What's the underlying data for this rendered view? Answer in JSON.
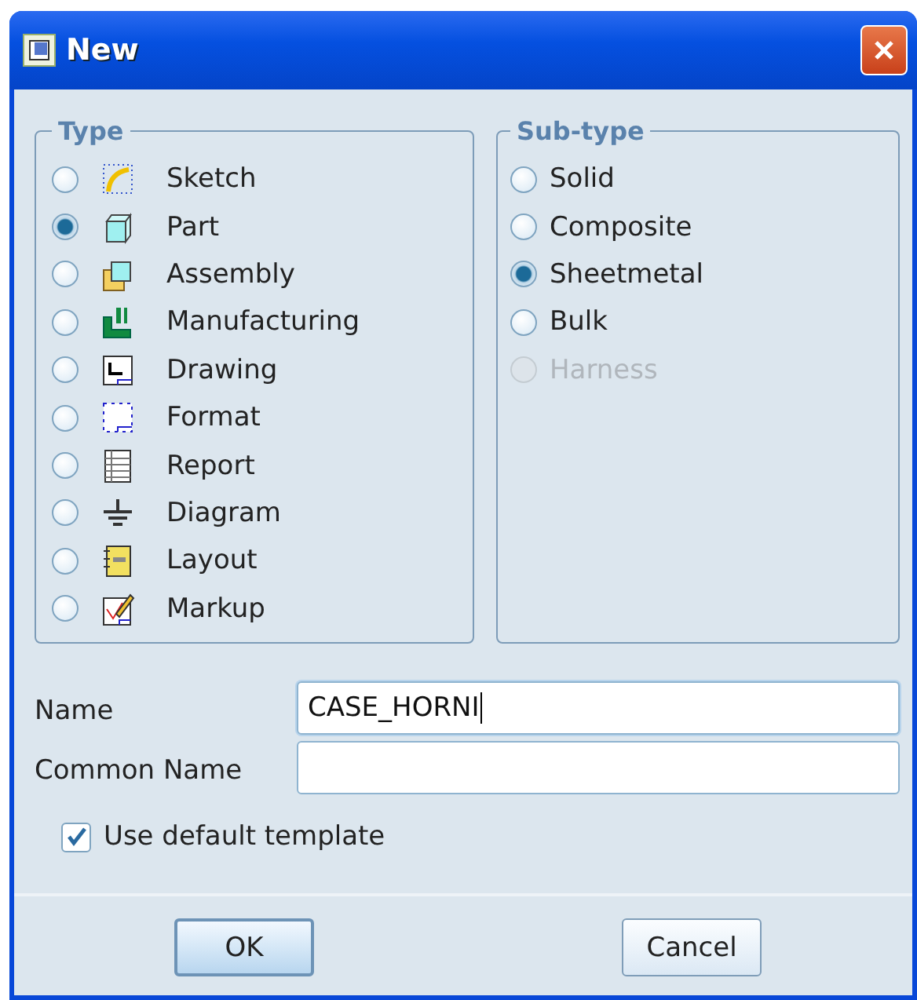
{
  "window": {
    "title": "New"
  },
  "type": {
    "title": "Type",
    "options": [
      {
        "label": "Sketch",
        "kind": "sketch",
        "selected": false
      },
      {
        "label": "Part",
        "kind": "part",
        "selected": true
      },
      {
        "label": "Assembly",
        "kind": "assembly",
        "selected": false
      },
      {
        "label": "Manufacturing",
        "kind": "manufacturing",
        "selected": false
      },
      {
        "label": "Drawing",
        "kind": "drawing",
        "selected": false
      },
      {
        "label": "Format",
        "kind": "format",
        "selected": false
      },
      {
        "label": "Report",
        "kind": "report",
        "selected": false
      },
      {
        "label": "Diagram",
        "kind": "diagram",
        "selected": false
      },
      {
        "label": "Layout",
        "kind": "layout",
        "selected": false
      },
      {
        "label": "Markup",
        "kind": "markup",
        "selected": false
      }
    ]
  },
  "subtype": {
    "title": "Sub-type",
    "options": [
      {
        "label": "Solid",
        "selected": false,
        "disabled": false
      },
      {
        "label": "Composite",
        "selected": false,
        "disabled": false
      },
      {
        "label": "Sheetmetal",
        "selected": true,
        "disabled": false
      },
      {
        "label": "Bulk",
        "selected": false,
        "disabled": false
      },
      {
        "label": "Harness",
        "selected": false,
        "disabled": true
      }
    ]
  },
  "fields": [
    {
      "label": "Name",
      "value": "CASE_HORNI",
      "focused": true
    },
    {
      "label": "Common Name",
      "focused": false
    }
  ],
  "use_default_template": {
    "label": "Use default template",
    "checked": true
  },
  "buttons": [
    {
      "label": "OK",
      "default": true
    },
    {
      "label": "Cancel",
      "default": false
    }
  ]
}
